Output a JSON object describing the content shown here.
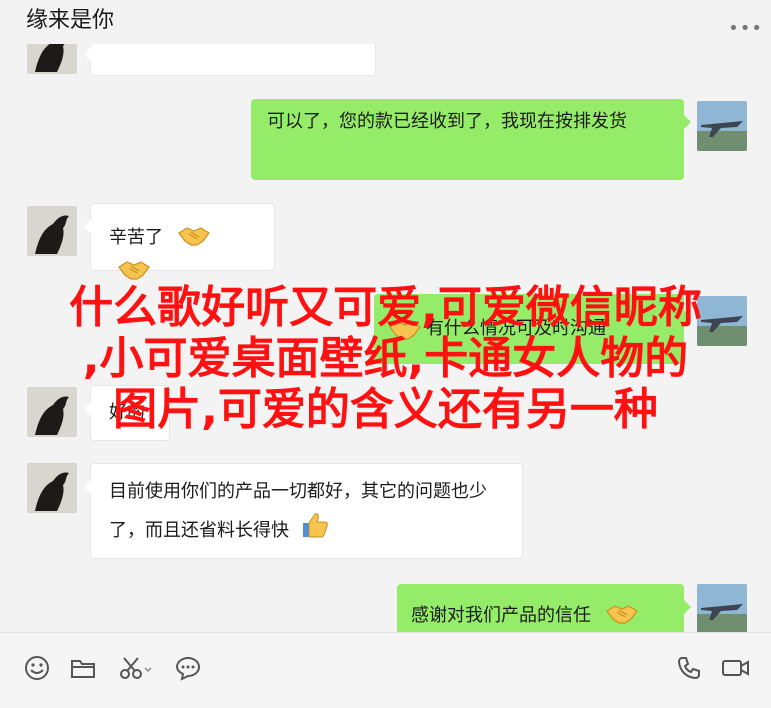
{
  "header": {
    "title": "缘来是你",
    "more_icon": "more-dots-icon"
  },
  "messages": [
    {
      "side": "left",
      "avatar": "horse-avatar",
      "text": ""
    },
    {
      "side": "right",
      "avatar": "jet-avatar",
      "text": "可以了，您的款已经收到了，我现在按排发货"
    },
    {
      "side": "left",
      "avatar": "horse-avatar",
      "text": "辛苦了",
      "emoji": [
        "handshake-emoji",
        "handshake-emoji"
      ]
    },
    {
      "side": "right",
      "avatar": "jet-avatar",
      "text": "有什么情况可及时沟通",
      "emoji": [
        "handshake-emoji"
      ]
    },
    {
      "side": "left",
      "avatar": "horse-avatar",
      "text": "好的"
    },
    {
      "side": "left",
      "avatar": "horse-avatar",
      "text": "目前使用你们的产品一切都好，其它的问题也少了，而且还省料长得快",
      "emoji": [
        "thumbs-up-emoji"
      ]
    },
    {
      "side": "right",
      "avatar": "jet-avatar",
      "text": "感谢对我们产品的信任",
      "emoji": [
        "handshake-emoji"
      ]
    }
  ],
  "overlay": {
    "line1": "什么歌好听又可爱,可爱微信昵称",
    "line2": ",小可爱桌面壁纸,卡通女人物的",
    "line3": "图片,可爱的含义还有另一种",
    "color": "#ff1111"
  },
  "toolbar": {
    "left_icons": [
      "emoji-icon",
      "folder-icon",
      "scissors-icon",
      "chat-bubble-icon"
    ],
    "right_icons": [
      "phone-icon",
      "video-icon"
    ]
  },
  "colors": {
    "background": "#f3f3f3",
    "bubble_right": "#95ec69",
    "bubble_left": "#ffffff"
  }
}
